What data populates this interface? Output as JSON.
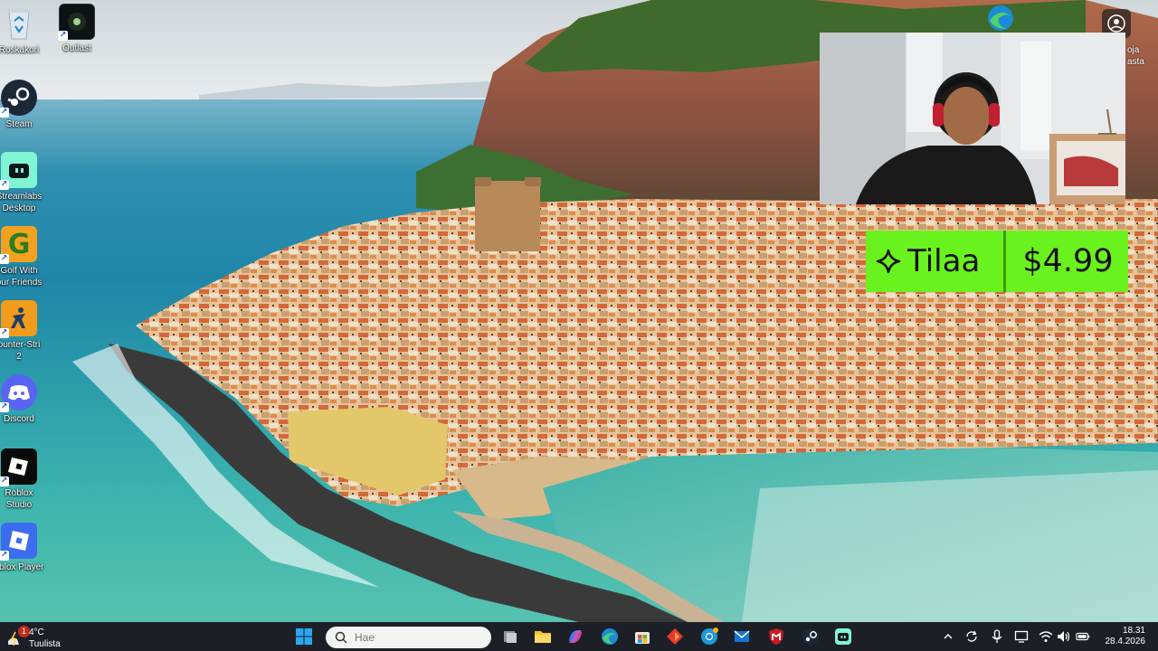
{
  "desktop": {
    "icons": [
      {
        "label": "Roskakori",
        "icon": "recycle-bin-icon"
      },
      {
        "label": "Outlast",
        "icon": "outlast-icon"
      },
      {
        "label": "Steam",
        "icon": "steam-icon"
      },
      {
        "label": "Streamlabs\nDesktop",
        "icon": "streamlabs-icon"
      },
      {
        "label": "Golf With\nour Friends",
        "icon": "golf-with-friends-icon"
      },
      {
        "label": "ounter-Stri\n2",
        "icon": "counter-strike-icon"
      },
      {
        "label": "Discord",
        "icon": "discord-icon"
      },
      {
        "label": "Roblox\nStudio",
        "icon": "roblox-studio-icon"
      },
      {
        "label": "oblox Player",
        "icon": "roblox-player-icon"
      }
    ],
    "right_labels": [
      "oja",
      "asta"
    ]
  },
  "overlay": {
    "subscribe_label": "Tilaa",
    "subscribe_price": "$4.99",
    "accent": "#6af21e"
  },
  "taskbar": {
    "weather": {
      "badge": "1",
      "temp": "4°C",
      "desc": "Tuulista"
    },
    "search_placeholder": "Hae",
    "pinned": [
      "start-icon",
      "search-icon",
      "task-view-icon",
      "file-explorer-icon",
      "copilot-icon",
      "edge-icon",
      "microsoft-store-icon",
      "office-icon",
      "chrome-icon",
      "mail-icon",
      "mcafee-icon",
      "steam-icon",
      "streamlabs-icon"
    ],
    "tray": [
      "chevron-up-icon",
      "onedrive-sync-icon",
      "microphone-icon",
      "display-icon",
      "wifi-icon",
      "volume-icon",
      "battery-icon"
    ],
    "time": "18.31",
    "date": "28.4.2026"
  }
}
